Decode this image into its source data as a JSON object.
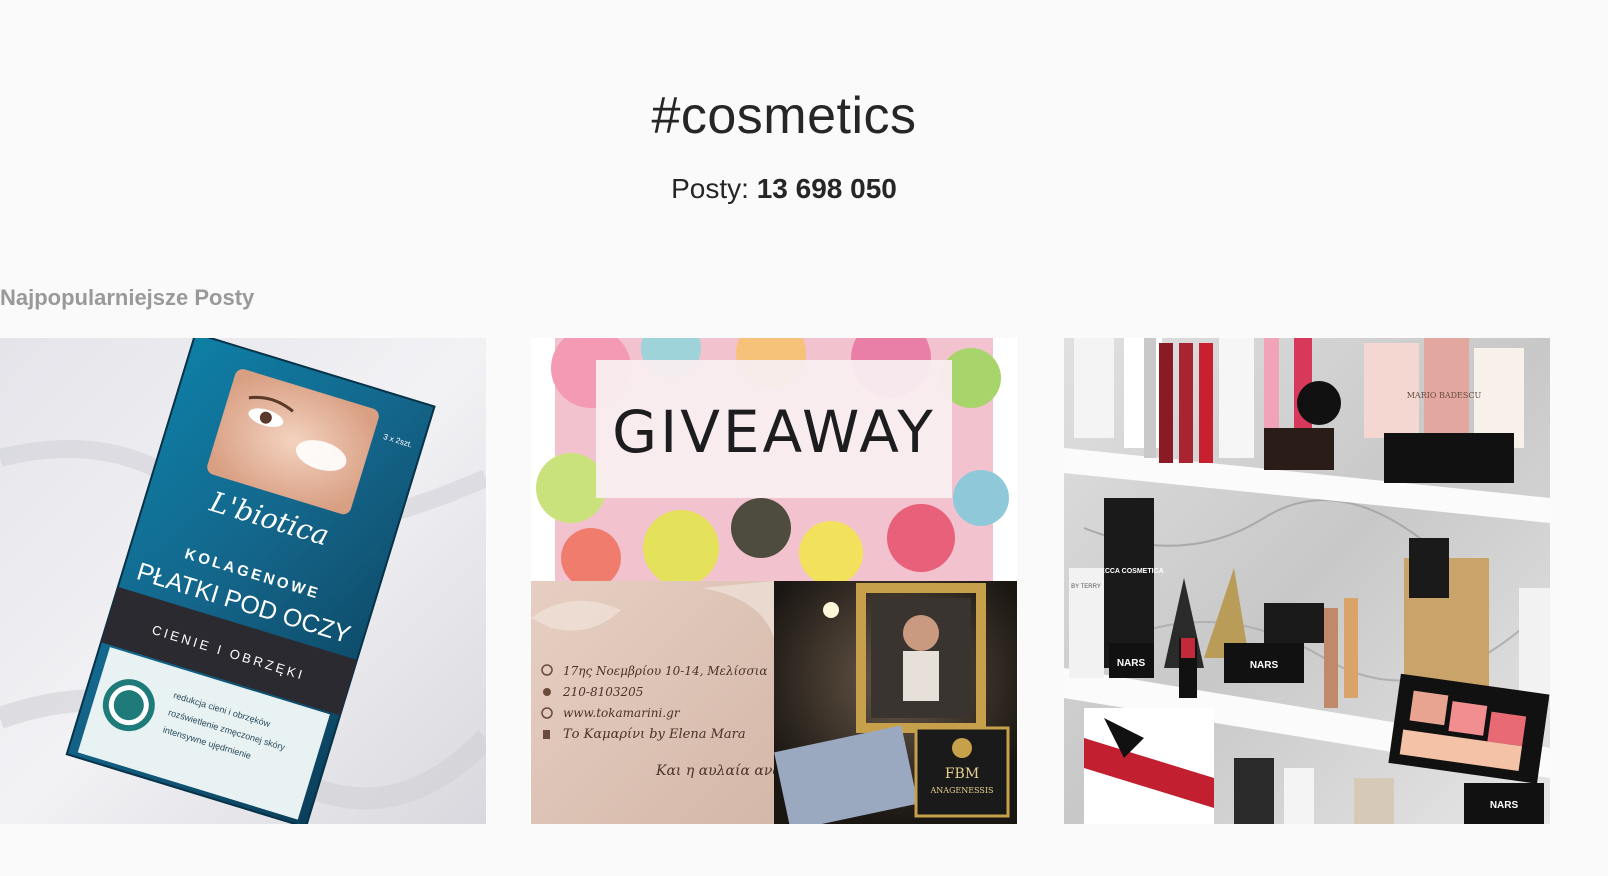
{
  "header": {
    "hashtag": "#cosmetics",
    "posts_label": "Posty:",
    "posts_count": "13 698 050"
  },
  "section": {
    "title": "Najpopularniejsze Posty"
  },
  "posts": [
    {
      "brand": "L'biotica",
      "product_line1": "KOLAGENOWE",
      "product_line2": "PŁATKI POD OCZY",
      "product_sub": "CIENIE I OBRZĘKI",
      "size": "3 x 2szt.",
      "bullet1": "redukcja cieni i obrzęków",
      "bullet2": "rozświetlenie zmęczonej skóry",
      "bullet3": "intensywne ujędrnienie"
    },
    {
      "headline": "GIVEAWAY",
      "card_line1": "17ης Νοεμβρίου 10-14, Μελίσσια",
      "card_line2": "210-8103205",
      "card_line3": "www.tokamarini.gr",
      "card_line4": "Το Καμαρίνι by Elena Mara",
      "card_line5": "Και η αυλαία ανο",
      "badge_line1": "FBM",
      "badge_line2": "ANAGENESSIS"
    },
    {
      "brand1": "MECCA COSMETICA",
      "brand2": "NARS",
      "brand3": "NARS",
      "brand4": "NARS",
      "brand5": "BY TERRY",
      "brand6": "MARIO BADESCU"
    }
  ],
  "colors": {
    "background": "#fafafa",
    "text": "#262626",
    "muted": "#999999"
  }
}
